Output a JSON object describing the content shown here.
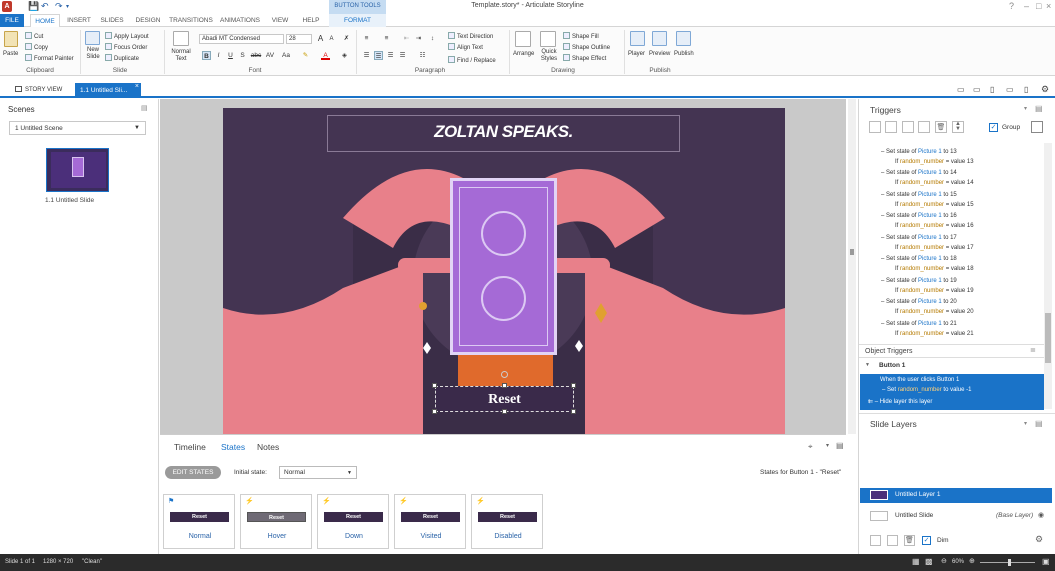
{
  "window": {
    "title": "Template.story* - Articulate Storyline",
    "app_icon_letter": "A",
    "context_tab_group": "BUTTON TOOLS"
  },
  "tabs": [
    {
      "label": "FILE"
    },
    {
      "label": "HOME"
    },
    {
      "label": "INSERT"
    },
    {
      "label": "SLIDES"
    },
    {
      "label": "DESIGN"
    },
    {
      "label": "TRANSITIONS"
    },
    {
      "label": "ANIMATIONS"
    },
    {
      "label": "VIEW"
    },
    {
      "label": "HELP"
    },
    {
      "label": "FORMAT"
    }
  ],
  "ribbon": {
    "clipboard": {
      "paste": "Paste",
      "cut": "Cut",
      "copy": "Copy",
      "format_painter": "Format Painter",
      "group": "Clipboard"
    },
    "slide": {
      "new_slide": "New Slide",
      "apply_layout": "Apply Layout",
      "focus_order": "Focus Order",
      "duplicate": "Duplicate",
      "group": "Slide"
    },
    "font": {
      "normal_text": "Normal Text",
      "font_name": "Abadi MT Condensed",
      "font_size": "28",
      "group": "Font",
      "bold": "B",
      "italic": "I",
      "underline": "U",
      "strike": "S",
      "abc": "abc",
      "av": "AV",
      "aa": "Aa",
      "grow": "A",
      "shrink": "A"
    },
    "paragraph": {
      "text_direction": "Text Direction",
      "align_text": "Align Text",
      "find_replace": "Find / Replace",
      "group": "Paragraph"
    },
    "drawing": {
      "arrange": "Arrange",
      "quick_styles": "Quick Styles",
      "shape_fill": "Shape Fill",
      "shape_outline": "Shape Outline",
      "shape_effect": "Shape Effect",
      "group": "Drawing"
    },
    "publish": {
      "player": "Player",
      "preview": "Preview",
      "publish": "Publish",
      "group": "Publish"
    }
  },
  "doc_tabs": {
    "story_view": "STORY VIEW",
    "active": "1.1 Untitled Sli..."
  },
  "scenes": {
    "title": "Scenes",
    "selected_scene": "1 Untitled Scene",
    "slide_label": "1.1 Untitled Slide"
  },
  "slide": {
    "heading": "ZOLTAN SPEAKS.",
    "button_label": "Reset",
    "bg_color": "#443452",
    "card_color": "#a56ad6"
  },
  "bottom": {
    "tabs": [
      "Timeline",
      "States",
      "Notes"
    ],
    "edit_states": "EDIT STATES",
    "initial_state_label": "Initial state:",
    "initial_state_value": "Normal",
    "states_for": "States for Button 1 - \"Reset\"",
    "states": [
      {
        "name": "Normal",
        "btn": "Reset",
        "color": "#3a2a4a"
      },
      {
        "name": "Hover",
        "btn": "Reset",
        "color": "#6f6a75"
      },
      {
        "name": "Down",
        "btn": "Reset",
        "color": "#3a2a4a"
      },
      {
        "name": "Visited",
        "btn": "Reset",
        "color": "#3a2a4a"
      },
      {
        "name": "Disabled",
        "btn": "Reset",
        "color": "#3a2a4a"
      }
    ]
  },
  "triggers": {
    "title": "Triggers",
    "group_label": "Group",
    "items": [
      {
        "action": "Set state of",
        "obj": "Picture 1",
        "to": "to 13",
        "cond": "If",
        "var": "random_number",
        "val": "= value 13"
      },
      {
        "action": "Set state of",
        "obj": "Picture 1",
        "to": "to 14",
        "cond": "If",
        "var": "random_number",
        "val": "= value 14"
      },
      {
        "action": "Set state of",
        "obj": "Picture 1",
        "to": "to 15",
        "cond": "If",
        "var": "random_number",
        "val": "= value 15"
      },
      {
        "action": "Set state of",
        "obj": "Picture 1",
        "to": "to 16",
        "cond": "If",
        "var": "random_number",
        "val": "= value 16"
      },
      {
        "action": "Set state of",
        "obj": "Picture 1",
        "to": "to 17",
        "cond": "If",
        "var": "random_number",
        "val": "= value 17"
      },
      {
        "action": "Set state of",
        "obj": "Picture 1",
        "to": "to 18",
        "cond": "If",
        "var": "random_number",
        "val": "= value 18"
      },
      {
        "action": "Set state of",
        "obj": "Picture 1",
        "to": "to 19",
        "cond": "If",
        "var": "random_number",
        "val": "= value 19"
      },
      {
        "action": "Set state of",
        "obj": "Picture 1",
        "to": "to 20",
        "cond": "If",
        "var": "random_number",
        "val": "= value 20"
      },
      {
        "action": "Set state of",
        "obj": "Picture 1",
        "to": "to 21",
        "cond": "If",
        "var": "random_number",
        "val": "= value 21"
      }
    ],
    "object_triggers": "Object Triggers",
    "button_group": "Button 1",
    "sel1": "When the user clicks Button 1",
    "sel2a": "Set ",
    "sel2b": "random_number",
    "sel2c": " to value -1",
    "sel3": "Hide layer this layer"
  },
  "slide_layers": {
    "title": "Slide Layers",
    "layer1": "Untitled Layer 1",
    "base": "Untitled Slide",
    "base_tag": "(Base Layer)",
    "dim": "Dim"
  },
  "status": {
    "slide": "Slide 1 of 1",
    "size": "1280 × 720",
    "state": "\"Clean\"",
    "zoom": "60%"
  }
}
